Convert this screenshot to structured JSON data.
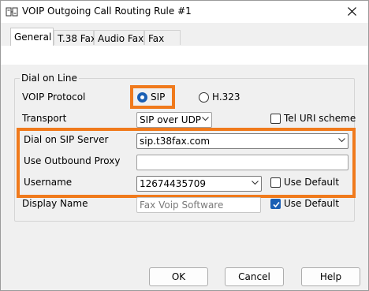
{
  "window": {
    "title": "VOIP Outgoing Call Routing Rule #1"
  },
  "tabs": [
    {
      "label": "General"
    },
    {
      "label": "T.38 Fax"
    },
    {
      "label": "Audio Fax"
    },
    {
      "label": "Fax"
    }
  ],
  "group": {
    "label": "Dial on Line"
  },
  "voip_protocol": {
    "label": "VOIP Protocol",
    "options": [
      {
        "label": "SIP",
        "selected": true
      },
      {
        "label": "H.323",
        "selected": false
      }
    ]
  },
  "transport": {
    "label": "Transport",
    "value": "SIP over UDP",
    "tel_uri": {
      "label": "Tel URI scheme",
      "checked": false
    }
  },
  "sip_server": {
    "label": "Dial on SIP Server",
    "value": "sip.t38fax.com"
  },
  "outbound_proxy": {
    "label": "Use Outbound Proxy",
    "value": ""
  },
  "username": {
    "label": "Username",
    "value": "12674435709",
    "use_default": {
      "label": "Use Default",
      "checked": false
    }
  },
  "display_name": {
    "label": "Display Name",
    "value": "Fax Voip Software",
    "use_default": {
      "label": "Use Default",
      "checked": true
    }
  },
  "buttons": {
    "ok": "OK",
    "cancel": "Cancel",
    "help": "Help"
  },
  "colors": {
    "highlight": "#f07a1c",
    "accent": "#1a5fb4"
  }
}
